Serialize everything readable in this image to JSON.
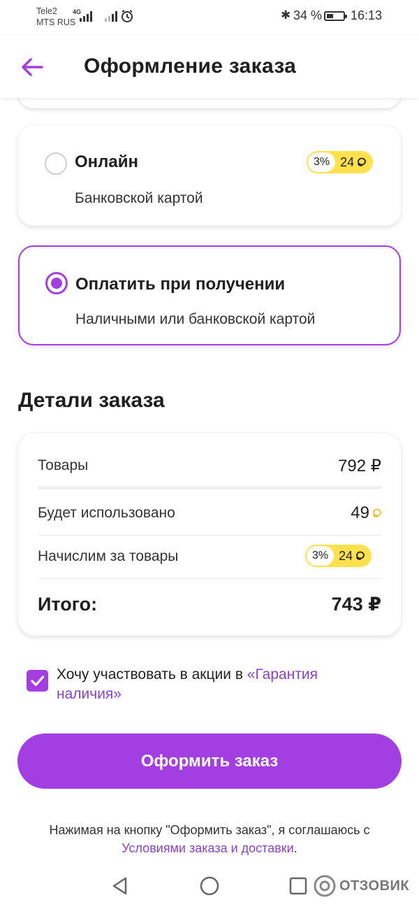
{
  "status_bar": {
    "carrier1": "Tele2",
    "carrier2": "MTS RUS",
    "network": "4G",
    "battery_pct": "34 %",
    "time": "16:13"
  },
  "header": {
    "title": "Оформление заказа"
  },
  "payment": {
    "online": {
      "title": "Онлайн",
      "subtitle": "Банковской картой",
      "cashback_pct": "3%",
      "cashback_points": "24",
      "selected": false
    },
    "on_delivery": {
      "title": "Оплатить при получении",
      "subtitle": "Наличными или банковской картой",
      "selected": true
    }
  },
  "details": {
    "title": "Детали заказа",
    "goods_label": "Товары",
    "goods_value": "792 ₽",
    "used_label": "Будет использовано",
    "used_value": "49",
    "accrue_label": "Начислим за товары",
    "accrue_pct": "3%",
    "accrue_points": "24",
    "total_label": "Итого:",
    "total_value": "743 ₽"
  },
  "promo": {
    "checked": true,
    "text": "Хочу участвовать в акции в ",
    "link": "«Гарантия наличия»"
  },
  "submit_label": "Оформить заказ",
  "legal": {
    "text": "Нажимая на кнопку \"Оформить заказ\", я соглашаюсь с",
    "link": "Условиями заказа и доставки",
    "end": "."
  },
  "watermark": "ОТЗОВИК",
  "colors": {
    "accent": "#a33ee2",
    "badge": "#ffe14d"
  }
}
